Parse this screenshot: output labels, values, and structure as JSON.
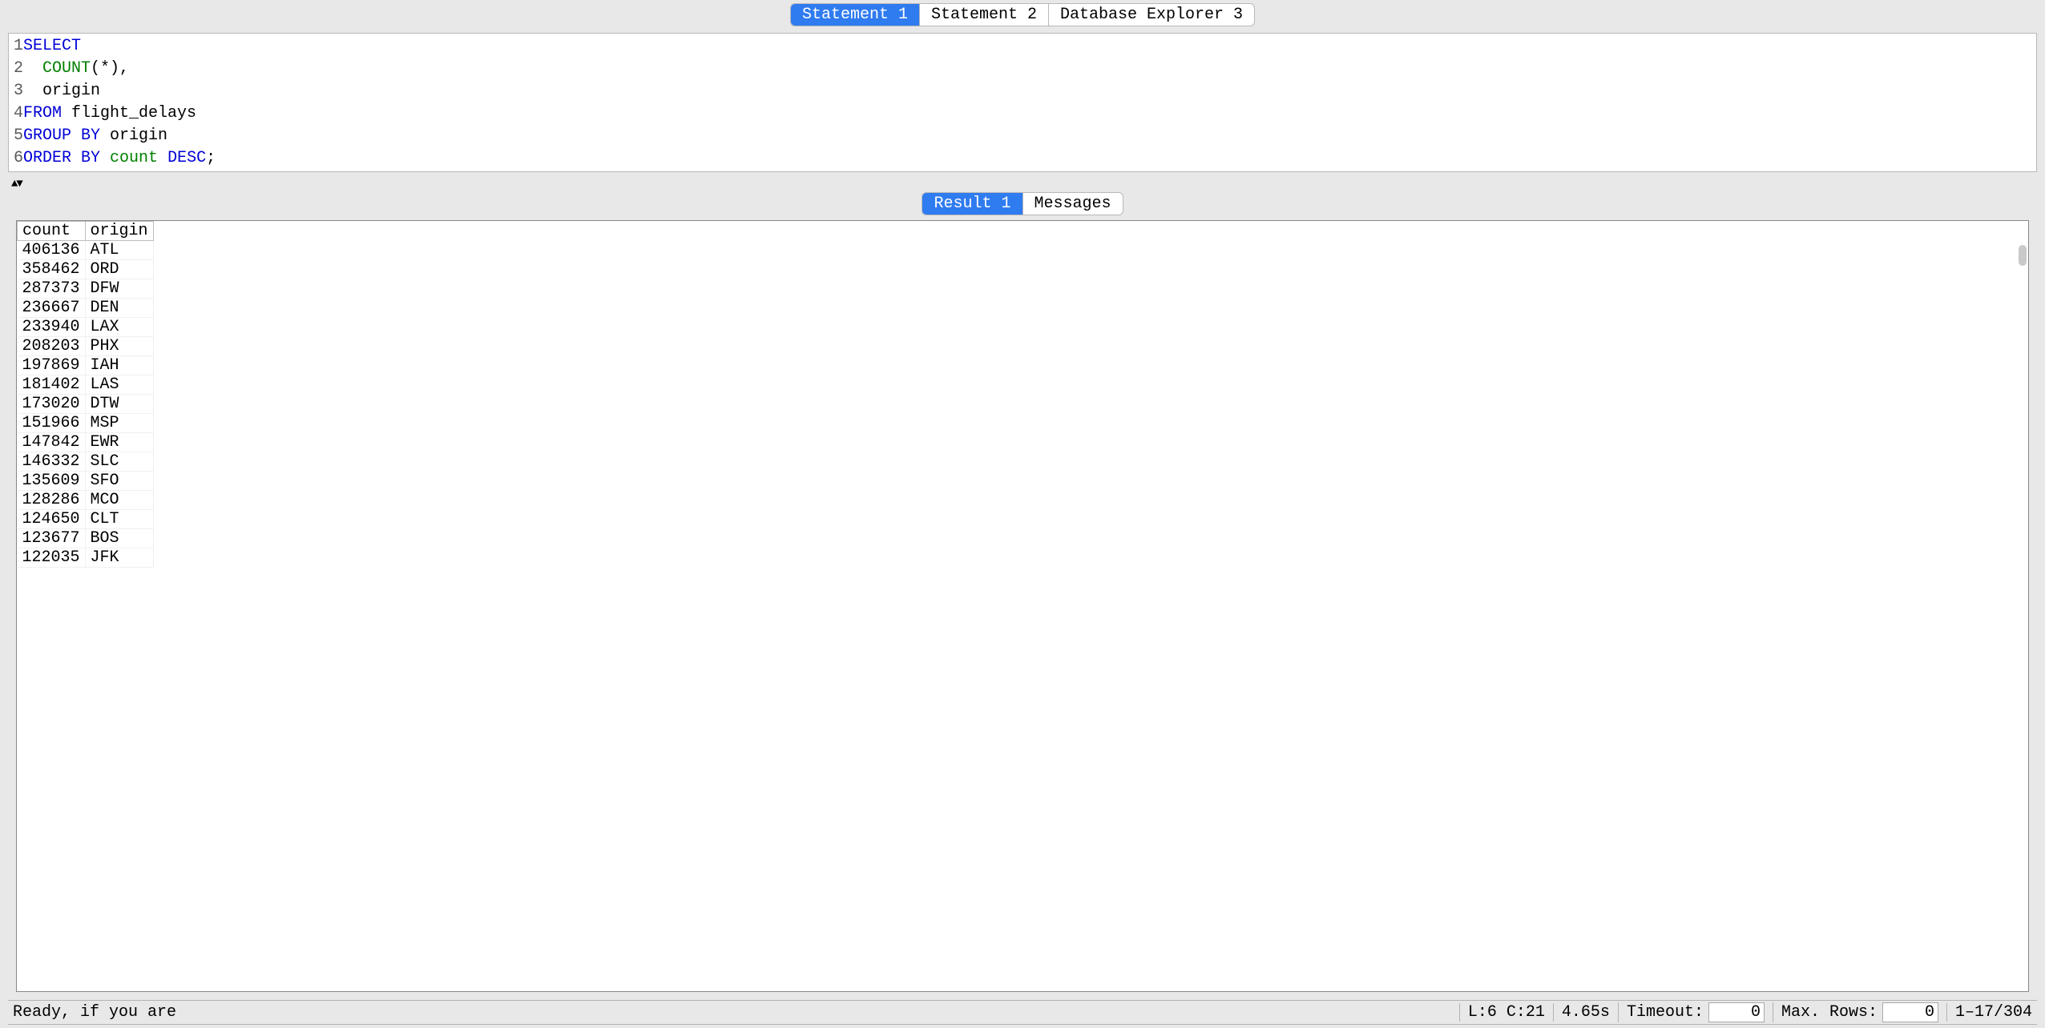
{
  "tabs": [
    {
      "label": "Statement 1",
      "active": true
    },
    {
      "label": "Statement 2",
      "active": false
    },
    {
      "label": "Database Explorer 3",
      "active": false
    }
  ],
  "code_lines": [
    [
      {
        "t": "SELECT",
        "c": "kw"
      }
    ],
    [
      {
        "t": "  ",
        "c": "id"
      },
      {
        "t": "COUNT",
        "c": "fn"
      },
      {
        "t": "(*),",
        "c": "id"
      }
    ],
    [
      {
        "t": "  origin",
        "c": "id"
      }
    ],
    [
      {
        "t": "FROM",
        "c": "kw"
      },
      {
        "t": " flight_delays",
        "c": "id"
      }
    ],
    [
      {
        "t": "GROUP BY",
        "c": "kw"
      },
      {
        "t": " origin",
        "c": "id"
      }
    ],
    [
      {
        "t": "ORDER BY",
        "c": "kw"
      },
      {
        "t": " ",
        "c": "id"
      },
      {
        "t": "count",
        "c": "fn"
      },
      {
        "t": " ",
        "c": "id"
      },
      {
        "t": "DESC",
        "c": "kw"
      },
      {
        "t": ";",
        "c": "id"
      }
    ]
  ],
  "result_tabs": [
    {
      "label": "Result 1",
      "active": true
    },
    {
      "label": "Messages",
      "active": false
    }
  ],
  "columns": [
    "count",
    "origin"
  ],
  "rows": [
    {
      "count": "406136",
      "origin": "ATL"
    },
    {
      "count": "358462",
      "origin": "ORD"
    },
    {
      "count": "287373",
      "origin": "DFW"
    },
    {
      "count": "236667",
      "origin": "DEN"
    },
    {
      "count": "233940",
      "origin": "LAX"
    },
    {
      "count": "208203",
      "origin": "PHX"
    },
    {
      "count": "197869",
      "origin": "IAH"
    },
    {
      "count": "181402",
      "origin": "LAS"
    },
    {
      "count": "173020",
      "origin": "DTW"
    },
    {
      "count": "151966",
      "origin": "MSP"
    },
    {
      "count": "147842",
      "origin": "EWR"
    },
    {
      "count": "146332",
      "origin": "SLC"
    },
    {
      "count": "135609",
      "origin": "SFO"
    },
    {
      "count": "128286",
      "origin": "MCO"
    },
    {
      "count": "124650",
      "origin": "CLT"
    },
    {
      "count": "123677",
      "origin": "BOS"
    },
    {
      "count": "122035",
      "origin": "JFK"
    }
  ],
  "status": {
    "message": "Ready, if you are",
    "cursor": "L:6 C:21",
    "elapsed": "4.65s",
    "timeout_label": "Timeout:",
    "timeout_value": "0",
    "maxrows_label": "Max. Rows:",
    "maxrows_value": "0",
    "range": "1–17/304"
  }
}
